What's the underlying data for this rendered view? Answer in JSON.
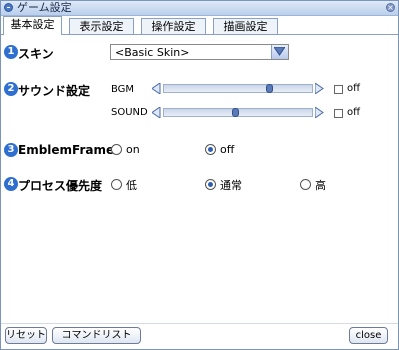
{
  "window": {
    "title": "ゲーム設定",
    "close_symbol": "×"
  },
  "tabs": [
    {
      "label": "基本設定",
      "active": true
    },
    {
      "label": "表示設定",
      "active": false
    },
    {
      "label": "操作設定",
      "active": false
    },
    {
      "label": "描画設定",
      "active": false
    }
  ],
  "settings": {
    "skin": {
      "badge": "1",
      "label": "スキン",
      "value": "<Basic Skin>"
    },
    "sound": {
      "badge": "2",
      "label": "サウンド設定",
      "bgm": {
        "label": "BGM",
        "level": 0.72,
        "off_label": "off",
        "off_checked": false
      },
      "se": {
        "label": "SOUND",
        "level": 0.48,
        "off_label": "off",
        "off_checked": false
      }
    },
    "emblem": {
      "badge": "3",
      "label": "EmblemFrame",
      "options": [
        "on",
        "off"
      ],
      "selected": "off"
    },
    "process": {
      "badge": "4",
      "label": "プロセス優先度",
      "options": [
        "低",
        "通常",
        "高"
      ],
      "selected": "通常"
    }
  },
  "buttons": {
    "reset": "リセット",
    "command_list": "コマンドリスト",
    "close": "close"
  },
  "colors": {
    "accent": "#2f6fcf",
    "titlebar": "#b9cfec"
  }
}
